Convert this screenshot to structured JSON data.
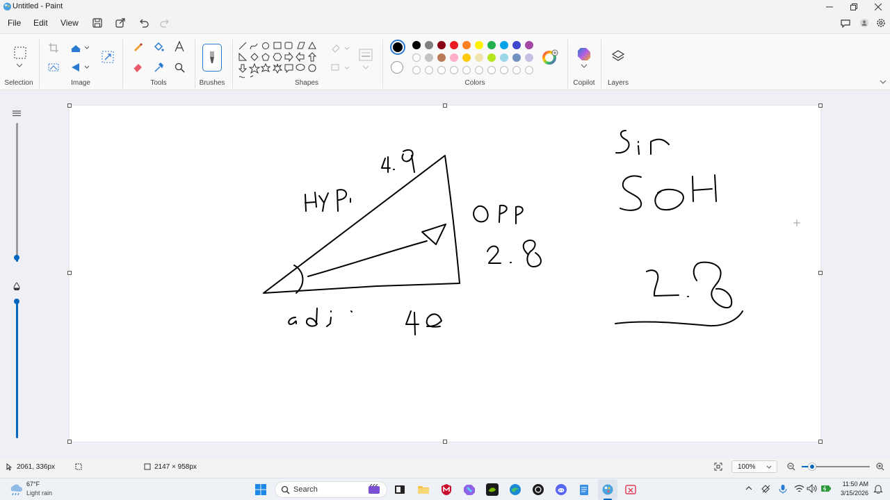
{
  "window": {
    "title": "Untitled - Paint"
  },
  "menu": {
    "file": "File",
    "edit": "Edit",
    "view": "View"
  },
  "ribbon": {
    "groups": {
      "selection": "Selection",
      "image": "Image",
      "tools": "Tools",
      "brushes": "Brushes",
      "shapes": "Shapes",
      "colors": "Colors",
      "copilot": "Copilot",
      "layers": "Layers"
    },
    "palette_row1": [
      "#000000",
      "#7f7f7f",
      "#880015",
      "#ed1c24",
      "#ff7f27",
      "#fff200",
      "#22b14c",
      "#00a2e8",
      "#3f48cc",
      "#a349a4"
    ],
    "palette_row2": [
      "#ffffff",
      "#c3c3c3",
      "#b97a57",
      "#ffaec9",
      "#ffc90e",
      "#efe4b0",
      "#b5e61d",
      "#99d9ea",
      "#7092be",
      "#c8bfe7"
    ],
    "palette_row3_count": 10,
    "color1": "#000000",
    "color2": "#ffffff"
  },
  "canvas": {
    "background": "#ffffff",
    "ink": "#000000"
  },
  "status": {
    "cursor_position": "2061, 336px",
    "canvas_size": "2147 × 958px",
    "zoom": "100%"
  },
  "taskbar": {
    "weather_temp": "67°F",
    "weather_desc": "Light rain",
    "search_placeholder": "Search",
    "time": "11:50 AM",
    "date": "3/15/2026"
  }
}
